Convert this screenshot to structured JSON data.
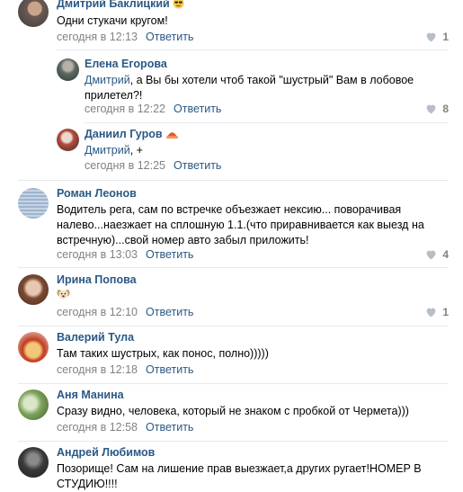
{
  "comments": [
    {
      "author": "Дмитрий Баклицкий",
      "badge": "cool-face-emoji",
      "text": "Одни стукачи кругом!",
      "time": "сегодня в 12:13",
      "reply": "Ответить",
      "likes": "1"
    },
    {
      "author": "Елена Егорова",
      "mention": "Дмитрий",
      "text": ", а Вы бы хотели чтоб такой \"шустрый\" Вам в лобовое прилетел?!",
      "time": "сегодня в 12:22",
      "reply": "Ответить",
      "likes": "8"
    },
    {
      "author": "Даниил Гуров",
      "badge": "hat-emoji",
      "mention": "Дмитрий",
      "text": ", +",
      "time": "сегодня в 12:25",
      "reply": "Ответить"
    },
    {
      "author": "Роман Леонов",
      "text": "Водитель рега, сам по встречке объезжает нексию... поворачивая налево...наезжает на сплошную 1.1.(что приравнивается как выезд на встречную)...свой номер авто забыл приложить!",
      "time": "сегодня в 13:03",
      "reply": "Ответить",
      "likes": "4"
    },
    {
      "author": "Ирина Попова",
      "badge": "dog-face-emoji",
      "time": "сегодня в 12:10",
      "reply": "Ответить",
      "likes": "1"
    },
    {
      "author": "Валерий Тула",
      "text": "Там таких шустрых, как понос, полно)))))",
      "time": "сегодня в 12:18",
      "reply": "Ответить"
    },
    {
      "author": "Аня Манина",
      "text": "Сразу видно, человека, который не знаком с пробкой от Чермета)))",
      "time": "сегодня в 12:58",
      "reply": "Ответить"
    },
    {
      "author": "Андрей Любимов",
      "text": "Позорище! Сам на лишение прав выезжает,а других ругает!НОМЕР В СТУДИЮ!!!!"
    }
  ],
  "colors": {
    "link": "#2a5885",
    "meta": "#828282",
    "separator": "#e7e8ec"
  }
}
